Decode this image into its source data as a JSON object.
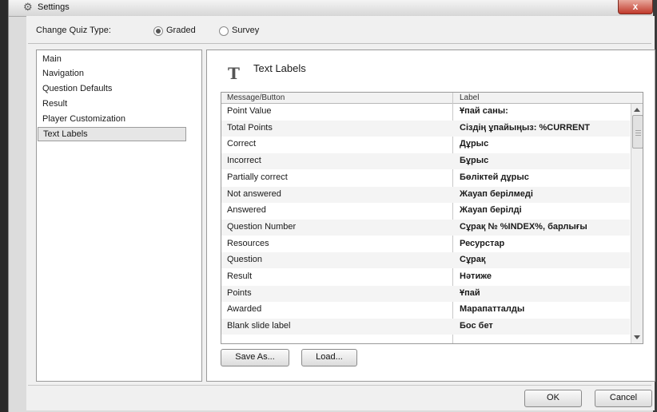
{
  "window": {
    "title": "Settings",
    "close_glyph": "x"
  },
  "quiz_type": {
    "label": "Change Quiz Type:",
    "options": [
      {
        "label": "Graded",
        "selected": true
      },
      {
        "label": "Survey",
        "selected": false
      }
    ]
  },
  "sidebar": {
    "items": [
      {
        "label": "Main"
      },
      {
        "label": "Navigation"
      },
      {
        "label": "Question Defaults"
      },
      {
        "label": "Result"
      },
      {
        "label": "Player Customization"
      },
      {
        "label": "Text Labels",
        "selected": true
      }
    ]
  },
  "panel": {
    "icon": "text-T-icon",
    "icon_glyph": "T",
    "title": "Text Labels",
    "table": {
      "headers": {
        "message": "Message/Button",
        "label": "Label"
      },
      "rows": [
        {
          "message": "Point Value",
          "label": "Ұпай саны:"
        },
        {
          "message": "Total Points",
          "label": "Сіздің ұпайыңыз: %CURRENT"
        },
        {
          "message": "Correct",
          "label": "Дұрыс"
        },
        {
          "message": "Incorrect",
          "label": "Бұрыс"
        },
        {
          "message": "Partially correct",
          "label": "Бөліктей дұрыс"
        },
        {
          "message": "Not answered",
          "label": "Жауап берілмеді"
        },
        {
          "message": "Answered",
          "label": "Жауап берілді"
        },
        {
          "message": "Question Number",
          "label": "Сұрақ № %INDEX%, барлығы"
        },
        {
          "message": "Resources",
          "label": "Ресурстар"
        },
        {
          "message": "Question",
          "label": "Сұрақ"
        },
        {
          "message": "Result",
          "label": "Нәтиже"
        },
        {
          "message": "Points",
          "label": "Ұпай"
        },
        {
          "message": "Awarded",
          "label": "Марапатталды"
        },
        {
          "message": "Blank slide label",
          "label": "Бос бет"
        }
      ]
    },
    "buttons": {
      "save_as": "Save As...",
      "load": "Load..."
    }
  },
  "footer": {
    "ok": "OK",
    "cancel": "Cancel"
  }
}
